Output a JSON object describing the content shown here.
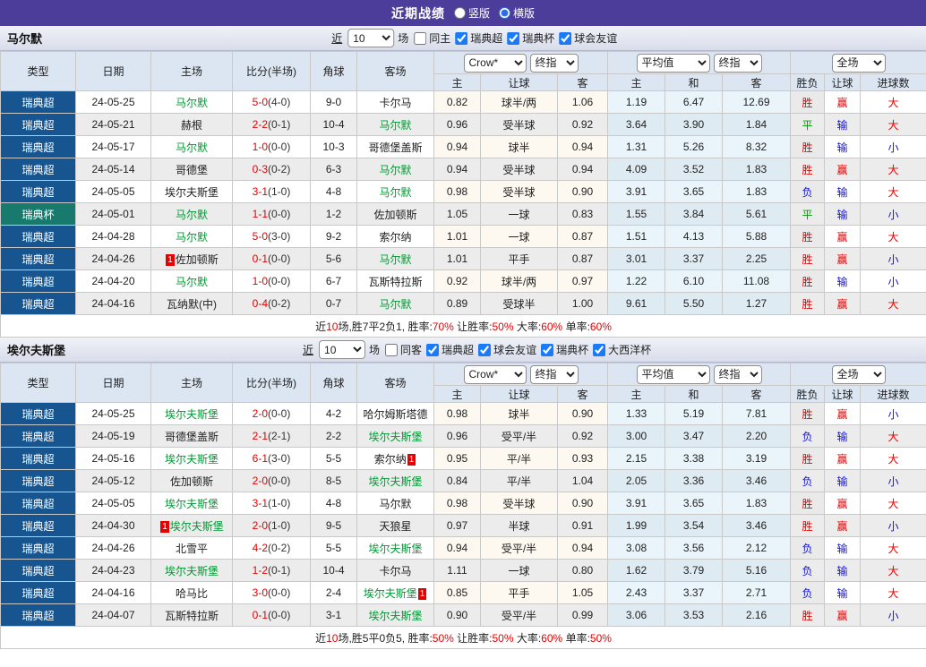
{
  "topbar": {
    "title": "近期战绩",
    "radios": [
      {
        "label": "竖版",
        "checked": false
      },
      {
        "label": "横版",
        "checked": true
      }
    ]
  },
  "colors": {
    "accent_purple": "#4c3d9b",
    "league_super_bg": "#175590",
    "league_cup_bg": "#177a6d",
    "highlight_team": "#009933",
    "win_red": "#e80000",
    "lose_blue": "#1414cc",
    "draw_green": "#009900"
  },
  "sections": [
    {
      "title": "马尔默",
      "filter": {
        "near": "近",
        "count": "10",
        "unit": "场",
        "same": {
          "label": "同主",
          "checked": false
        },
        "leagues": [
          {
            "label": "瑞典超",
            "checked": true
          },
          {
            "label": "瑞典杯",
            "checked": true
          },
          {
            "label": "球会友谊",
            "checked": true
          }
        ]
      },
      "selects": {
        "book": "Crow*",
        "book_kind": "终指",
        "avg": "平均值",
        "avg_kind": "终指",
        "scope": "全场"
      },
      "headers": {
        "type": "类型",
        "date": "日期",
        "home": "主场",
        "score": "比分(半场)",
        "corner": "角球",
        "away": "客场",
        "h": "主",
        "handicap": "让球",
        "a": "客",
        "avg_h": "主",
        "avg_d": "和",
        "avg_a": "客",
        "result": "胜负",
        "handicap_result": "让球",
        "goals": "进球数"
      },
      "rows": [
        {
          "league": "瑞典超",
          "cup": false,
          "date": "24-05-25",
          "home": {
            "name": "马尔默",
            "hl": true
          },
          "score": "5-0",
          "half": "(4-0)",
          "corner": "9-0",
          "away": {
            "name": "卡尔马",
            "hl": false
          },
          "odds": [
            "0.82",
            "球半/两",
            "1.06"
          ],
          "avg": [
            "1.19",
            "6.47",
            "12.69"
          ],
          "res": [
            [
              "胜",
              "r"
            ],
            [
              "赢",
              "r"
            ],
            [
              "大",
              "r"
            ]
          ]
        },
        {
          "league": "瑞典超",
          "cup": false,
          "date": "24-05-21",
          "home": {
            "name": "赫根",
            "hl": false
          },
          "score": "2-2",
          "half": "(0-1)",
          "corner": "10-4",
          "away": {
            "name": "马尔默",
            "hl": true
          },
          "odds": [
            "0.96",
            "受半球",
            "0.92"
          ],
          "avg": [
            "3.64",
            "3.90",
            "1.84"
          ],
          "res": [
            [
              "平",
              "g"
            ],
            [
              "输",
              "b"
            ],
            [
              "大",
              "r"
            ]
          ]
        },
        {
          "league": "瑞典超",
          "cup": false,
          "date": "24-05-17",
          "home": {
            "name": "马尔默",
            "hl": true
          },
          "score": "1-0",
          "half": "(0-0)",
          "corner": "10-3",
          "away": {
            "name": "哥德堡盖斯",
            "hl": false
          },
          "odds": [
            "0.94",
            "球半",
            "0.94"
          ],
          "avg": [
            "1.31",
            "5.26",
            "8.32"
          ],
          "res": [
            [
              "胜",
              "r"
            ],
            [
              "输",
              "b"
            ],
            [
              "小",
              "b"
            ]
          ]
        },
        {
          "league": "瑞典超",
          "cup": false,
          "date": "24-05-14",
          "home": {
            "name": "哥德堡",
            "hl": false
          },
          "score": "0-3",
          "half": "(0-2)",
          "corner": "6-3",
          "away": {
            "name": "马尔默",
            "hl": true
          },
          "odds": [
            "0.94",
            "受半球",
            "0.94"
          ],
          "avg": [
            "4.09",
            "3.52",
            "1.83"
          ],
          "res": [
            [
              "胜",
              "r"
            ],
            [
              "赢",
              "r"
            ],
            [
              "大",
              "r"
            ]
          ]
        },
        {
          "league": "瑞典超",
          "cup": false,
          "date": "24-05-05",
          "home": {
            "name": "埃尔夫斯堡",
            "hl": false
          },
          "score": "3-1",
          "half": "(1-0)",
          "corner": "4-8",
          "away": {
            "name": "马尔默",
            "hl": true
          },
          "odds": [
            "0.98",
            "受半球",
            "0.90"
          ],
          "avg": [
            "3.91",
            "3.65",
            "1.83"
          ],
          "res": [
            [
              "负",
              "b"
            ],
            [
              "输",
              "b"
            ],
            [
              "大",
              "r"
            ]
          ]
        },
        {
          "league": "瑞典杯",
          "cup": true,
          "date": "24-05-01",
          "home": {
            "name": "马尔默",
            "hl": true
          },
          "score": "1-1",
          "half": "(0-0)",
          "corner": "1-2",
          "away": {
            "name": "佐加顿斯",
            "hl": false
          },
          "odds": [
            "1.05",
            "一球",
            "0.83"
          ],
          "avg": [
            "1.55",
            "3.84",
            "5.61"
          ],
          "res": [
            [
              "平",
              "g"
            ],
            [
              "输",
              "b"
            ],
            [
              "小",
              "b"
            ]
          ]
        },
        {
          "league": "瑞典超",
          "cup": false,
          "date": "24-04-28",
          "home": {
            "name": "马尔默",
            "hl": true
          },
          "score": "5-0",
          "half": "(3-0)",
          "corner": "9-2",
          "away": {
            "name": "索尔纳",
            "hl": false
          },
          "odds": [
            "1.01",
            "一球",
            "0.87"
          ],
          "avg": [
            "1.51",
            "4.13",
            "5.88"
          ],
          "res": [
            [
              "胜",
              "r"
            ],
            [
              "赢",
              "r"
            ],
            [
              "大",
              "r"
            ]
          ]
        },
        {
          "league": "瑞典超",
          "cup": false,
          "date": "24-04-26",
          "home": {
            "name": "佐加顿斯",
            "hl": false,
            "badge": "1",
            "badge_pos": "before"
          },
          "score": "0-1",
          "half": "(0-0)",
          "corner": "5-6",
          "away": {
            "name": "马尔默",
            "hl": true
          },
          "odds": [
            "1.01",
            "平手",
            "0.87"
          ],
          "avg": [
            "3.01",
            "3.37",
            "2.25"
          ],
          "res": [
            [
              "胜",
              "r"
            ],
            [
              "赢",
              "r"
            ],
            [
              "小",
              "b"
            ]
          ]
        },
        {
          "league": "瑞典超",
          "cup": false,
          "date": "24-04-20",
          "home": {
            "name": "马尔默",
            "hl": true
          },
          "score": "1-0",
          "half": "(0-0)",
          "corner": "6-7",
          "away": {
            "name": "瓦斯特拉斯",
            "hl": false
          },
          "odds": [
            "0.92",
            "球半/两",
            "0.97"
          ],
          "avg": [
            "1.22",
            "6.10",
            "11.08"
          ],
          "res": [
            [
              "胜",
              "r"
            ],
            [
              "输",
              "b"
            ],
            [
              "小",
              "b"
            ]
          ]
        },
        {
          "league": "瑞典超",
          "cup": false,
          "date": "24-04-16",
          "home": {
            "name": "瓦纳默(中)",
            "hl": false
          },
          "score": "0-4",
          "half": "(0-2)",
          "corner": "0-7",
          "away": {
            "name": "马尔默",
            "hl": true
          },
          "odds": [
            "0.89",
            "受球半",
            "1.00"
          ],
          "avg": [
            "9.61",
            "5.50",
            "1.27"
          ],
          "res": [
            [
              "胜",
              "r"
            ],
            [
              "赢",
              "r"
            ],
            [
              "大",
              "r"
            ]
          ]
        }
      ],
      "summary": [
        [
          "近",
          false
        ],
        [
          "10",
          true
        ],
        [
          "场,胜7平2负1, 胜率:",
          false
        ],
        [
          "70%",
          true
        ],
        [
          " 让胜率:",
          false
        ],
        [
          "50%",
          true
        ],
        [
          " 大率:",
          false
        ],
        [
          "60%",
          true
        ],
        [
          " 单率:",
          false
        ],
        [
          "60%",
          true
        ]
      ]
    },
    {
      "title": "埃尔夫斯堡",
      "filter": {
        "near": "近",
        "count": "10",
        "unit": "场",
        "same": {
          "label": "同客",
          "checked": false
        },
        "leagues": [
          {
            "label": "瑞典超",
            "checked": true
          },
          {
            "label": "球会友谊",
            "checked": true
          },
          {
            "label": "瑞典杯",
            "checked": true
          },
          {
            "label": "大西洋杯",
            "checked": true
          }
        ]
      },
      "selects": {
        "book": "Crow*",
        "book_kind": "终指",
        "avg": "平均值",
        "avg_kind": "终指",
        "scope": "全场"
      },
      "headers": {
        "type": "类型",
        "date": "日期",
        "home": "主场",
        "score": "比分(半场)",
        "corner": "角球",
        "away": "客场",
        "h": "主",
        "handicap": "让球",
        "a": "客",
        "avg_h": "主",
        "avg_d": "和",
        "avg_a": "客",
        "result": "胜负",
        "handicap_result": "让球",
        "goals": "进球数"
      },
      "rows": [
        {
          "league": "瑞典超",
          "cup": false,
          "date": "24-05-25",
          "home": {
            "name": "埃尔夫斯堡",
            "hl": true
          },
          "score": "2-0",
          "half": "(0-0)",
          "corner": "4-2",
          "away": {
            "name": "哈尔姆斯塔德",
            "hl": false
          },
          "odds": [
            "0.98",
            "球半",
            "0.90"
          ],
          "avg": [
            "1.33",
            "5.19",
            "7.81"
          ],
          "res": [
            [
              "胜",
              "r"
            ],
            [
              "赢",
              "r"
            ],
            [
              "小",
              "b"
            ]
          ]
        },
        {
          "league": "瑞典超",
          "cup": false,
          "date": "24-05-19",
          "home": {
            "name": "哥德堡盖斯",
            "hl": false
          },
          "score": "2-1",
          "half": "(2-1)",
          "corner": "2-2",
          "away": {
            "name": "埃尔夫斯堡",
            "hl": true
          },
          "odds": [
            "0.96",
            "受平/半",
            "0.92"
          ],
          "avg": [
            "3.00",
            "3.47",
            "2.20"
          ],
          "res": [
            [
              "负",
              "b"
            ],
            [
              "输",
              "b"
            ],
            [
              "大",
              "r"
            ]
          ]
        },
        {
          "league": "瑞典超",
          "cup": false,
          "date": "24-05-16",
          "home": {
            "name": "埃尔夫斯堡",
            "hl": true
          },
          "score": "6-1",
          "half": "(3-0)",
          "corner": "5-5",
          "away": {
            "name": "索尔纳",
            "hl": false,
            "badge": "1",
            "badge_pos": "after"
          },
          "odds": [
            "0.95",
            "平/半",
            "0.93"
          ],
          "avg": [
            "2.15",
            "3.38",
            "3.19"
          ],
          "res": [
            [
              "胜",
              "r"
            ],
            [
              "赢",
              "r"
            ],
            [
              "大",
              "r"
            ]
          ]
        },
        {
          "league": "瑞典超",
          "cup": false,
          "date": "24-05-12",
          "home": {
            "name": "佐加顿斯",
            "hl": false
          },
          "score": "2-0",
          "half": "(0-0)",
          "corner": "8-5",
          "away": {
            "name": "埃尔夫斯堡",
            "hl": true
          },
          "odds": [
            "0.84",
            "平/半",
            "1.04"
          ],
          "avg": [
            "2.05",
            "3.36",
            "3.46"
          ],
          "res": [
            [
              "负",
              "b"
            ],
            [
              "输",
              "b"
            ],
            [
              "小",
              "b"
            ]
          ]
        },
        {
          "league": "瑞典超",
          "cup": false,
          "date": "24-05-05",
          "home": {
            "name": "埃尔夫斯堡",
            "hl": true
          },
          "score": "3-1",
          "half": "(1-0)",
          "corner": "4-8",
          "away": {
            "name": "马尔默",
            "hl": false
          },
          "odds": [
            "0.98",
            "受半球",
            "0.90"
          ],
          "avg": [
            "3.91",
            "3.65",
            "1.83"
          ],
          "res": [
            [
              "胜",
              "r"
            ],
            [
              "赢",
              "r"
            ],
            [
              "大",
              "r"
            ]
          ]
        },
        {
          "league": "瑞典超",
          "cup": false,
          "date": "24-04-30",
          "home": {
            "name": "埃尔夫斯堡",
            "hl": true,
            "badge": "1",
            "badge_pos": "before"
          },
          "score": "2-0",
          "half": "(1-0)",
          "corner": "9-5",
          "away": {
            "name": "天狼星",
            "hl": false
          },
          "odds": [
            "0.97",
            "半球",
            "0.91"
          ],
          "avg": [
            "1.99",
            "3.54",
            "3.46"
          ],
          "res": [
            [
              "胜",
              "r"
            ],
            [
              "赢",
              "r"
            ],
            [
              "小",
              "b"
            ]
          ]
        },
        {
          "league": "瑞典超",
          "cup": false,
          "date": "24-04-26",
          "home": {
            "name": "北雪平",
            "hl": false
          },
          "score": "4-2",
          "half": "(0-2)",
          "corner": "5-5",
          "away": {
            "name": "埃尔夫斯堡",
            "hl": true
          },
          "odds": [
            "0.94",
            "受平/半",
            "0.94"
          ],
          "avg": [
            "3.08",
            "3.56",
            "2.12"
          ],
          "res": [
            [
              "负",
              "b"
            ],
            [
              "输",
              "b"
            ],
            [
              "大",
              "r"
            ]
          ]
        },
        {
          "league": "瑞典超",
          "cup": false,
          "date": "24-04-23",
          "home": {
            "name": "埃尔夫斯堡",
            "hl": true
          },
          "score": "1-2",
          "half": "(0-1)",
          "corner": "10-4",
          "away": {
            "name": "卡尔马",
            "hl": false
          },
          "odds": [
            "1.11",
            "一球",
            "0.80"
          ],
          "avg": [
            "1.62",
            "3.79",
            "5.16"
          ],
          "res": [
            [
              "负",
              "b"
            ],
            [
              "输",
              "b"
            ],
            [
              "大",
              "r"
            ]
          ]
        },
        {
          "league": "瑞典超",
          "cup": false,
          "date": "24-04-16",
          "home": {
            "name": "哈马比",
            "hl": false
          },
          "score": "3-0",
          "half": "(0-0)",
          "corner": "2-4",
          "away": {
            "name": "埃尔夫斯堡",
            "hl": true,
            "badge": "1",
            "badge_pos": "after"
          },
          "odds": [
            "0.85",
            "平手",
            "1.05"
          ],
          "avg": [
            "2.43",
            "3.37",
            "2.71"
          ],
          "res": [
            [
              "负",
              "b"
            ],
            [
              "输",
              "b"
            ],
            [
              "大",
              "r"
            ]
          ]
        },
        {
          "league": "瑞典超",
          "cup": false,
          "date": "24-04-07",
          "home": {
            "name": "瓦斯特拉斯",
            "hl": false
          },
          "score": "0-1",
          "half": "(0-0)",
          "corner": "3-1",
          "away": {
            "name": "埃尔夫斯堡",
            "hl": true
          },
          "odds": [
            "0.90",
            "受平/半",
            "0.99"
          ],
          "avg": [
            "3.06",
            "3.53",
            "2.16"
          ],
          "res": [
            [
              "胜",
              "r"
            ],
            [
              "赢",
              "r"
            ],
            [
              "小",
              "b"
            ]
          ]
        }
      ],
      "summary": [
        [
          "近",
          false
        ],
        [
          "10",
          true
        ],
        [
          "场,胜5平0负5, 胜率:",
          false
        ],
        [
          "50%",
          true
        ],
        [
          " 让胜率:",
          false
        ],
        [
          "50%",
          true
        ],
        [
          " 大率:",
          false
        ],
        [
          "60%",
          true
        ],
        [
          " 单率:",
          false
        ],
        [
          "50%",
          true
        ]
      ]
    }
  ]
}
